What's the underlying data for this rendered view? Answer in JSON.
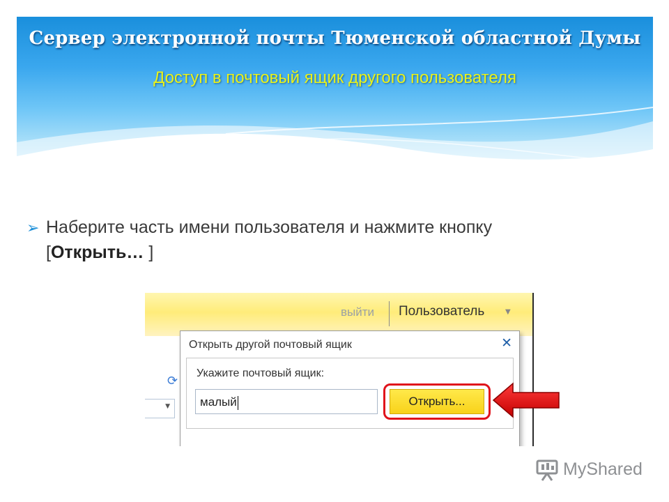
{
  "slide": {
    "title": "Сервер электронной почты Тюменской областной Думы",
    "subtitle": "Доступ в почтовый ящик другого пользователя",
    "bullet": {
      "line1": "Наберите часть имени пользователя и нажмите кнопку",
      "bracket_open": "[",
      "bold": "Открыть…",
      "bracket_close": " ]"
    }
  },
  "screenshot": {
    "signout_label": "выйти",
    "user_menu_label": "Пользователь",
    "dialog": {
      "title": "Открыть другой почтовый ящик",
      "prompt": "Укажите почтовый ящик:",
      "input_value": "малый",
      "open_button_label": "Открыть..."
    }
  },
  "watermark": "MyShared",
  "colors": {
    "header_blue": "#2e9ee6",
    "subtitle_yellow": "#e9f21b",
    "bullet_arrow": "#1d8fd8",
    "highlight_red": "#e0131b",
    "button_yellow": "#f8d21a"
  },
  "icons": [
    "arrow-bullet-icon",
    "close-icon",
    "refresh-icon",
    "dropdown-caret-icon",
    "red-arrow-icon",
    "myshared-logo-icon"
  ]
}
